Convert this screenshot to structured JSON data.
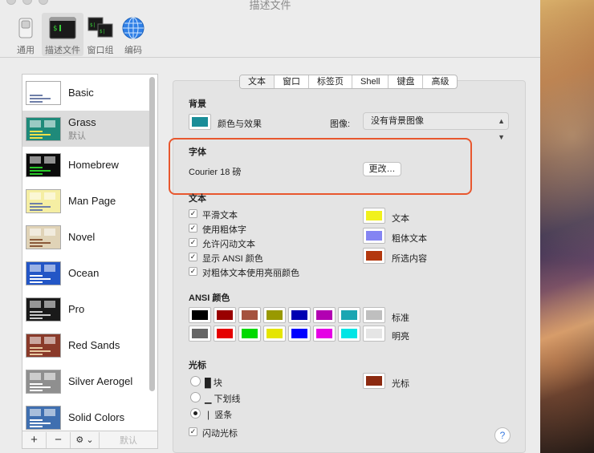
{
  "window": {
    "title": "描述文件"
  },
  "toolbar": {
    "items": [
      {
        "label": "通用",
        "icon": "switch-icon"
      },
      {
        "label": "描述文件",
        "icon": "terminal-icon"
      },
      {
        "label": "窗口组",
        "icon": "window-group-icon"
      },
      {
        "label": "编码",
        "icon": "globe-icon"
      }
    ]
  },
  "profiles": [
    {
      "name": "Basic",
      "sub": "",
      "colors": {
        "bg": "#ffffff",
        "fg": "#6f7fa8"
      }
    },
    {
      "name": "Grass",
      "sub": "默认",
      "colors": {
        "bg": "#1f8a7a",
        "fg": "#f2e14a"
      }
    },
    {
      "name": "Homebrew",
      "sub": "",
      "colors": {
        "bg": "#0b0b0b",
        "fg": "#28c828"
      }
    },
    {
      "name": "Man Page",
      "sub": "",
      "colors": {
        "bg": "#f5eea3",
        "fg": "#6f7fa8"
      }
    },
    {
      "name": "Novel",
      "sub": "",
      "colors": {
        "bg": "#e0d3b7",
        "fg": "#8a5a3a"
      }
    },
    {
      "name": "Ocean",
      "sub": "",
      "colors": {
        "bg": "#2356c6",
        "fg": "#ffffff"
      }
    },
    {
      "name": "Pro",
      "sub": "",
      "colors": {
        "bg": "#1a1a1a",
        "fg": "#c9c9c9"
      }
    },
    {
      "name": "Red Sands",
      "sub": "",
      "colors": {
        "bg": "#8a3a2a",
        "fg": "#e8c9a0"
      }
    },
    {
      "name": "Silver Aerogel",
      "sub": "",
      "colors": {
        "bg": "#8f8f8f",
        "fg": "#ffffff"
      }
    },
    {
      "name": "Solid Colors",
      "sub": "",
      "colors": {
        "bg": "#3f6fb0",
        "fg": "#ffffff"
      }
    }
  ],
  "list_bottom": {
    "add": "+",
    "remove": "−",
    "gear": "⚙ ⌄",
    "default": "默认"
  },
  "tabs": [
    "文本",
    "窗口",
    "标签页",
    "Shell",
    "键盘",
    "高级"
  ],
  "background_section": {
    "title": "背景",
    "color_label": "颜色与效果",
    "color": "#1a8d98",
    "image_label": "图像:",
    "image_value": "没有背景图像"
  },
  "font_section": {
    "title": "字体",
    "font": "Courier 18 磅",
    "change_button": "更改…"
  },
  "text_section": {
    "title": "文本",
    "options": [
      {
        "label": "平滑文本",
        "checked": "✓"
      },
      {
        "label": "使用粗体字",
        "checked": "✓"
      },
      {
        "label": "允许闪动文本",
        "checked": "✓"
      },
      {
        "label": "显示 ANSI 颜色",
        "checked": "✓"
      },
      {
        "label": "对粗体文本使用亮丽颜色",
        "checked": "✓"
      }
    ],
    "colors": [
      {
        "label": "文本",
        "color": "#f1f11c"
      },
      {
        "label": "粗体文本",
        "color": "#8484f2"
      },
      {
        "label": "所选内容",
        "color": "#b3380e"
      }
    ]
  },
  "ansi_section": {
    "title": "ANSI 颜色",
    "normal_label": "标准",
    "bright_label": "明亮",
    "normal": [
      "#000000",
      "#990000",
      "#a5523f",
      "#999900",
      "#0000b2",
      "#b200b2",
      "#1aa6b2",
      "#bfbfbf"
    ],
    "bright": [
      "#666666",
      "#e50000",
      "#00d900",
      "#e5e500",
      "#0000ff",
      "#e500e5",
      "#00e5e5",
      "#e5e5e5"
    ]
  },
  "cursor_section": {
    "title": "光标",
    "options": [
      {
        "label": "█ 块",
        "selected": false
      },
      {
        "label": "▁ 下划线",
        "selected": false
      },
      {
        "label": "❘ 竖条",
        "selected": true
      }
    ],
    "color_label": "光标",
    "color": "#8c2a10",
    "blink_label": "闪动光标",
    "blink_checked": "✓"
  },
  "help": "?"
}
